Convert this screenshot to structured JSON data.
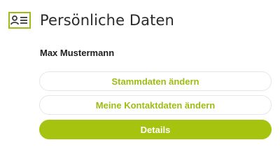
{
  "header": {
    "icon": "id-card-icon",
    "title": "Persönliche Daten"
  },
  "profile": {
    "name": "Max Mustermann"
  },
  "buttons": {
    "master_data": "Stammdaten ändern",
    "contact_data": "Meine Kontaktdaten ändern",
    "details": "Details"
  },
  "colors": {
    "accent": "#a6c40f",
    "accent_text": "#9dbd12",
    "button_border": "#e6e6e6",
    "title_text": "#2b2b2b"
  }
}
